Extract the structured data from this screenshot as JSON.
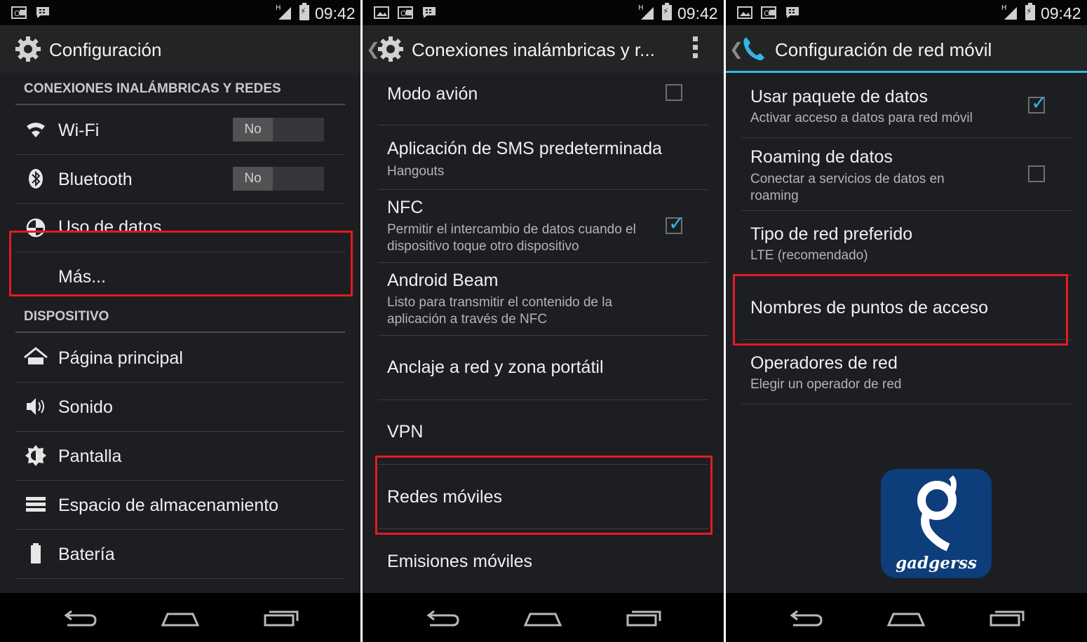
{
  "status_bar": {
    "time": "09:42",
    "network": "H"
  },
  "screen1": {
    "title": "Configuración",
    "sections": [
      {
        "header": "CONEXIONES INALÁMBRICAS Y REDES",
        "items": [
          {
            "label": "Wi-Fi",
            "toggle": "No",
            "icon": "wifi-icon"
          },
          {
            "label": "Bluetooth",
            "toggle": "No",
            "icon": "bluetooth-icon"
          },
          {
            "label": "Uso de datos",
            "icon": "data-usage-icon"
          },
          {
            "label": "Más..."
          }
        ]
      },
      {
        "header": "DISPOSITIVO",
        "items": [
          {
            "label": "Página principal",
            "icon": "home-icon"
          },
          {
            "label": "Sonido",
            "icon": "sound-icon"
          },
          {
            "label": "Pantalla",
            "icon": "display-icon"
          },
          {
            "label": "Espacio de almacenamiento",
            "icon": "storage-icon"
          },
          {
            "label": "Batería",
            "icon": "battery-icon"
          }
        ]
      }
    ]
  },
  "screen2": {
    "title": "Conexiones inalámbricas y r...",
    "items": [
      {
        "title": "Modo avión",
        "checked": false
      },
      {
        "title": "Aplicación de SMS predeterminada",
        "subtitle": "Hangouts"
      },
      {
        "title": "NFC",
        "subtitle": "Permitir el intercambio de datos cuando el dispositivo toque otro dispositivo",
        "checked": true
      },
      {
        "title": "Android Beam",
        "subtitle": "Listo para transmitir el contenido de la aplicación a través de NFC"
      },
      {
        "title": "Anclaje a red y zona portátil"
      },
      {
        "title": "VPN"
      },
      {
        "title": "Redes móviles"
      },
      {
        "title": "Emisiones móviles"
      }
    ]
  },
  "screen3": {
    "title": "Configuración de red móvil",
    "items": [
      {
        "title": "Usar paquete de datos",
        "subtitle": "Activar acceso a datos para red móvil",
        "checked": true
      },
      {
        "title": "Roaming de datos",
        "subtitle": "Conectar a servicios de datos en roaming",
        "checked": false
      },
      {
        "title": "Tipo de red preferido",
        "subtitle": "LTE (recomendado)"
      },
      {
        "title": "Nombres de puntos de acceso"
      },
      {
        "title": "Operadores de red",
        "subtitle": "Elegir un operador de red"
      }
    ],
    "logo_text": "gadgerss"
  },
  "colors": {
    "accent": "#33b5e5",
    "highlight": "#e31b23",
    "background": "#1c1e21"
  }
}
